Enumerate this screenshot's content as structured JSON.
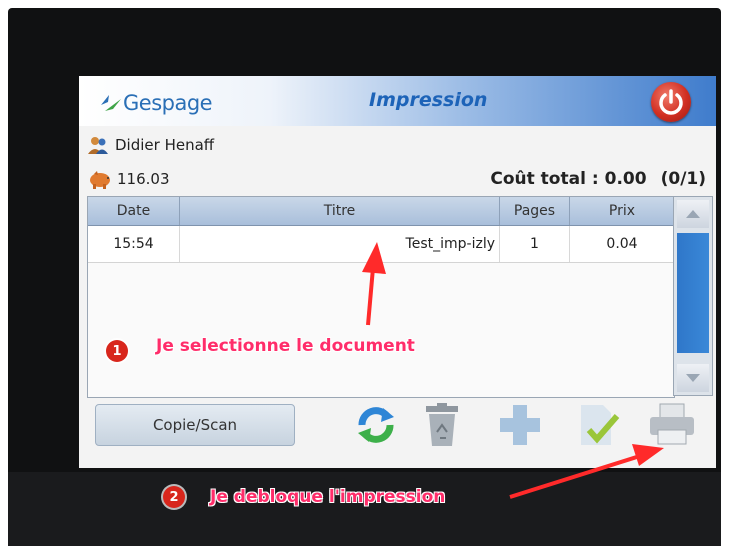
{
  "header": {
    "logo": "Gespage",
    "title": "Impression"
  },
  "user": {
    "name": "Didier Henaff",
    "credit": "116.03"
  },
  "summary": {
    "total_label": "Coût total :",
    "total_value": "0.00",
    "selection": "(0/1)"
  },
  "table": {
    "columns": [
      "Date",
      "Titre",
      "Pages",
      "Prix"
    ],
    "rows": [
      {
        "date": "15:54",
        "title": "Test_imp-izly",
        "pages": "1",
        "price": "0.04"
      }
    ]
  },
  "buttons": {
    "copy_scan": "Copie/Scan"
  },
  "annotations": [
    {
      "badge": "1",
      "text": "Je selectionne le document"
    },
    {
      "badge": "2",
      "text": "Je debloque l'impression"
    }
  ],
  "colors": {
    "accent": "#1d63b8",
    "annotation": "#ff2d6a",
    "badge": "#d8261c"
  },
  "icons": [
    "power-icon",
    "users-icon",
    "piggy-bank-icon",
    "refresh-icon",
    "recycle-bin-icon",
    "plus-icon",
    "document-check-icon",
    "printer-icon",
    "arrow-up-icon",
    "arrow-down-icon"
  ]
}
